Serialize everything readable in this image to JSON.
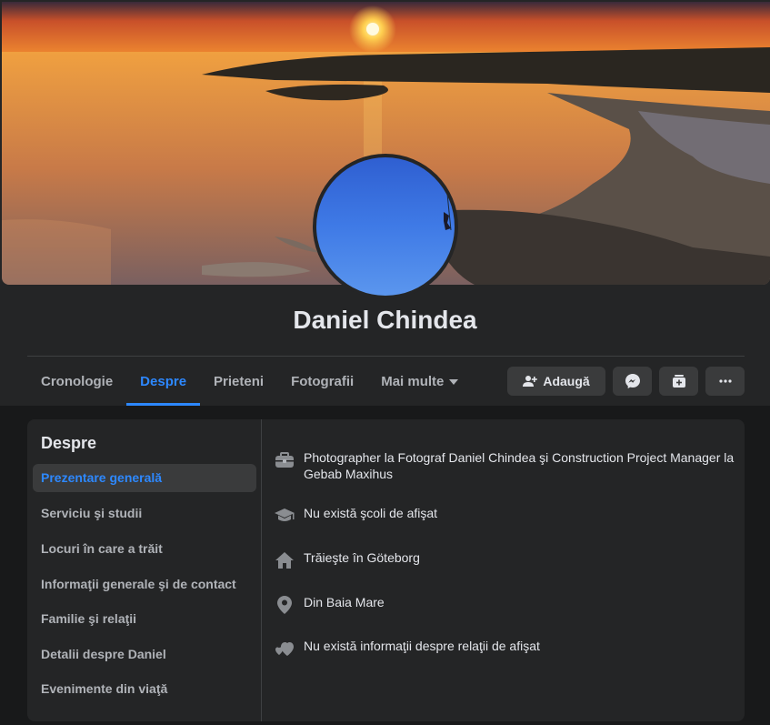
{
  "profile": {
    "name": "Daniel Chindea"
  },
  "tabs": [
    {
      "label": "Cronologie"
    },
    {
      "label": "Despre"
    },
    {
      "label": "Prieteni"
    },
    {
      "label": "Fotografii"
    },
    {
      "label": "Mai multe"
    }
  ],
  "actions": {
    "add_friend_label": "Adaugă"
  },
  "about": {
    "title": "Despre",
    "menu": [
      {
        "label": "Prezentare generală"
      },
      {
        "label": "Serviciu şi studii"
      },
      {
        "label": "Locuri în care a trăit"
      },
      {
        "label": "Informaţii generale şi de contact"
      },
      {
        "label": "Familie şi relaţii"
      },
      {
        "label": "Detalii despre Daniel"
      },
      {
        "label": "Evenimente din viaţă"
      }
    ],
    "overview": [
      {
        "icon": "briefcase-icon",
        "text": "Photographer la Fotograf Daniel Chindea şi Construction Project Manager la Gebab Maxihus"
      },
      {
        "icon": "graduation-cap-icon",
        "text": "Nu există şcoli de afişat"
      },
      {
        "icon": "home-icon",
        "text": "Trăieşte în Göteborg"
      },
      {
        "icon": "location-pin-icon",
        "text": "Din Baia Mare"
      },
      {
        "icon": "heart-icon",
        "text": "Nu există informaţii despre relaţii de afişat"
      }
    ]
  },
  "colors": {
    "accent": "#2d88ff",
    "background": "#18191a",
    "surface": "#242526",
    "button": "#3a3b3c",
    "text": "#e4e6eb",
    "secondary_text": "#b0b3b8"
  }
}
